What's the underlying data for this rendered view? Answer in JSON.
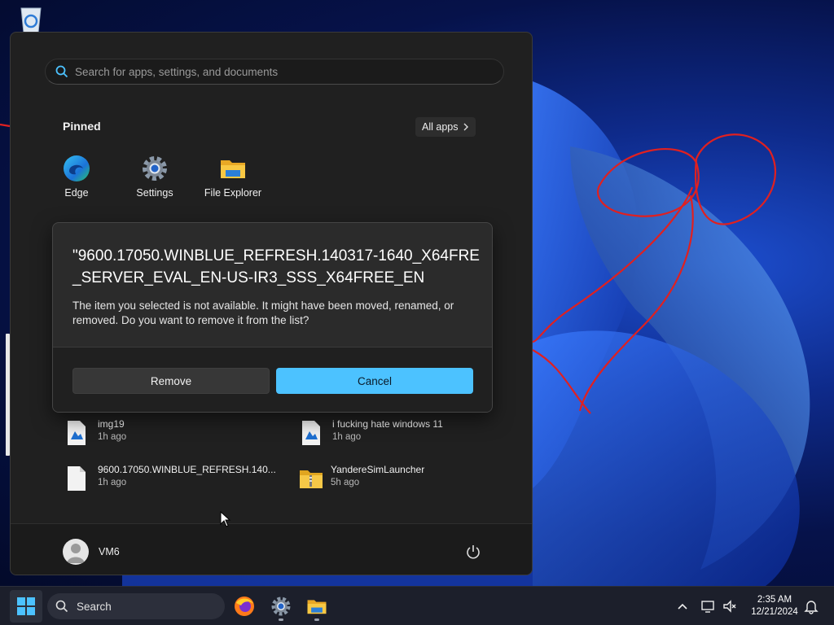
{
  "desktop": {
    "icons": [
      {
        "name": "recycle-bin-icon"
      }
    ]
  },
  "start_menu": {
    "search": {
      "placeholder": "Search for apps, settings, and documents",
      "value": ""
    },
    "pinned": {
      "title": "Pinned",
      "all_apps_label": "All apps",
      "apps": [
        {
          "label": "Edge",
          "icon": "edge-icon"
        },
        {
          "label": "Settings",
          "icon": "gear-icon"
        },
        {
          "label": "File Explorer",
          "icon": "folder-icon"
        }
      ]
    },
    "dialog": {
      "title": "\"9600.17050.WINBLUE_REFRESH.140317-1640_X64FRE_SERVER_EVAL_EN-US-IR3_SSS_X64FREE_EN",
      "message": "The item you selected is not available. It might have been moved, renamed, or removed. Do you want to remove it from the list?",
      "remove_label": "Remove",
      "cancel_label": "Cancel"
    },
    "recommended": [
      {
        "name": "img19",
        "time": "1h ago",
        "icon": "image-file-icon"
      },
      {
        "name": "i fucking hate windows 11",
        "time": "1h ago",
        "icon": "image-file-icon"
      },
      {
        "name": "9600.17050.WINBLUE_REFRESH.140...",
        "time": "1h ago",
        "icon": "file-icon"
      },
      {
        "name": "YandereSimLauncher",
        "time": "5h ago",
        "icon": "zip-folder-icon"
      }
    ],
    "user": {
      "name": "VM6"
    },
    "accent": "#4cc2ff"
  },
  "taskbar": {
    "search_label": "Search",
    "apps": [
      "firefox-icon",
      "gear-icon",
      "folder-icon"
    ],
    "clock": {
      "time": "2:35 AM",
      "date": "12/21/2024"
    }
  }
}
